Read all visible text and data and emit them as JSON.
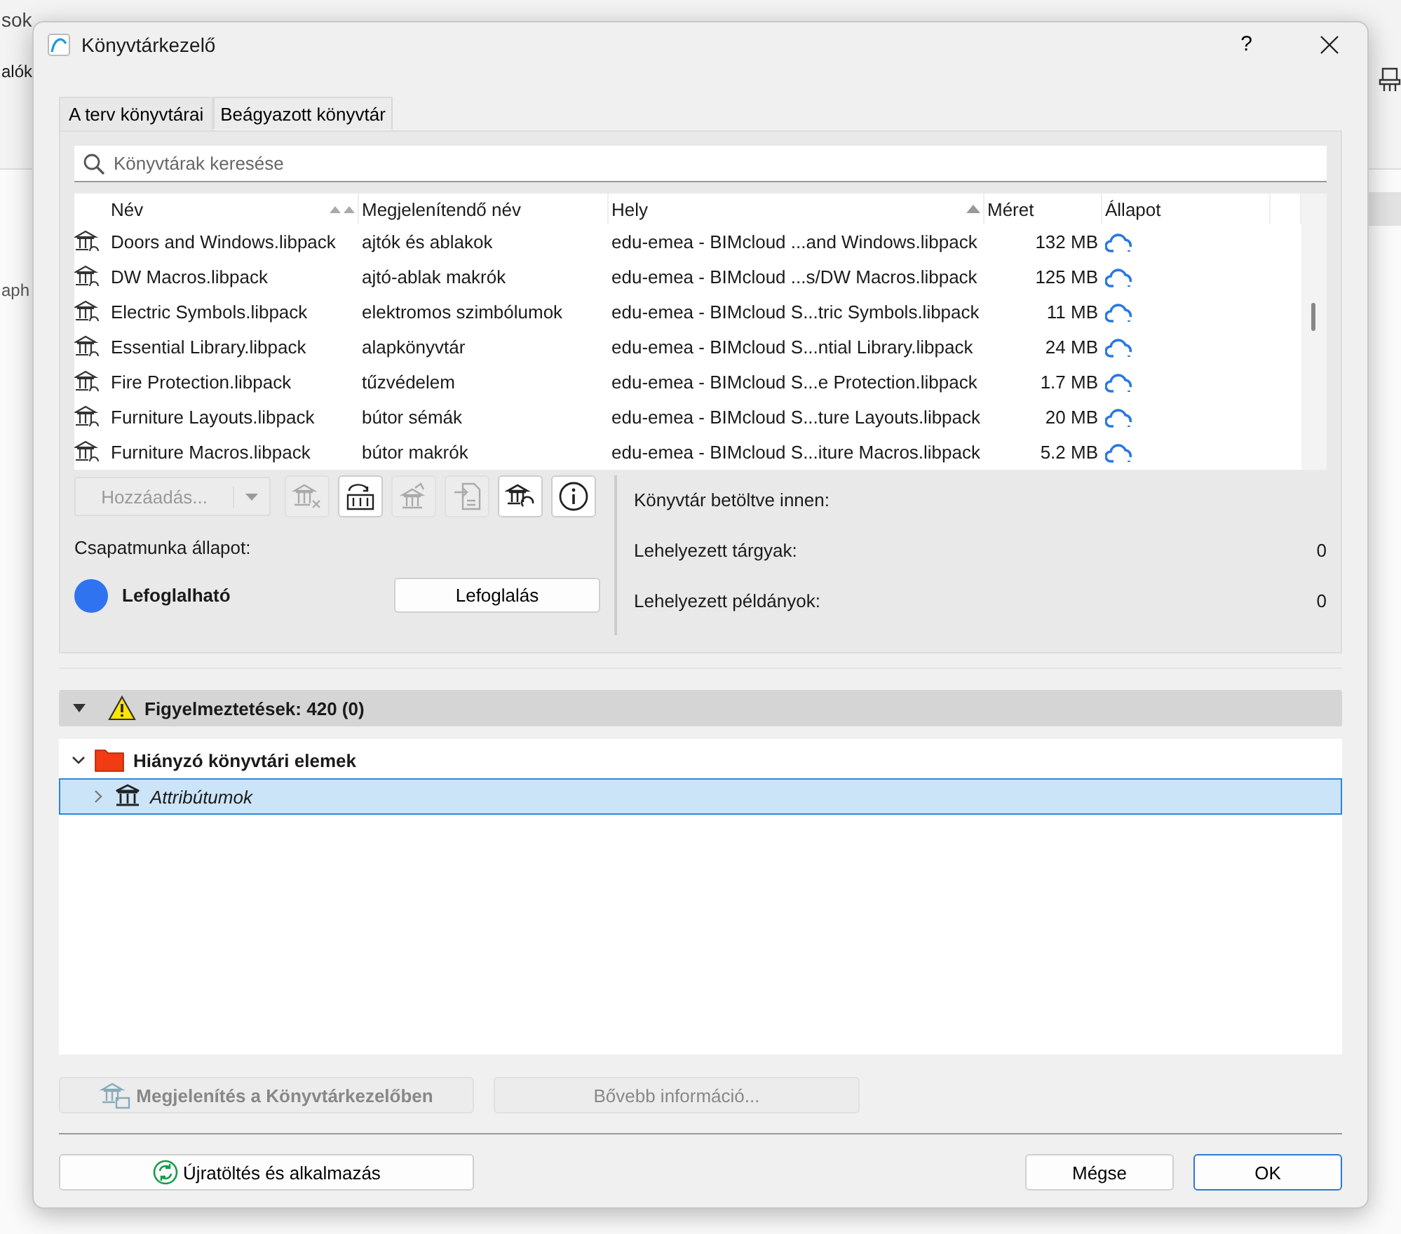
{
  "background_app": {
    "menu": [
      "sok"
    ],
    "toolbar_label": "alók",
    "side_label": "aph"
  },
  "window": {
    "title": "Könyvtárkezelő",
    "help": "?"
  },
  "tabs": [
    {
      "label": "A terv könyvtárai",
      "selected": true
    },
    {
      "label": "Beágyazott könyvtár",
      "selected": false
    }
  ],
  "search": {
    "placeholder": "Könyvtárak keresése"
  },
  "table": {
    "columns": [
      {
        "label": "Név",
        "kind": "sorted-multi"
      },
      {
        "label": "Megjelenítendő név",
        "kind": "plain"
      },
      {
        "label": "Hely",
        "kind": "sorted"
      },
      {
        "label": "Méret",
        "kind": "plain"
      },
      {
        "label": "Állapot",
        "kind": "plain"
      }
    ],
    "rows": [
      {
        "name": "Doors and Windows.libpack",
        "display": "ajtók és ablakok",
        "location": "edu-emea - BIMcloud ...and Windows.libpack",
        "size": "132 MB"
      },
      {
        "name": "DW Macros.libpack",
        "display": "ajtó-ablak makrók",
        "location": "edu-emea - BIMcloud ...s/DW Macros.libpack",
        "size": "125 MB"
      },
      {
        "name": "Electric Symbols.libpack",
        "display": "elektromos szimbólumok",
        "location": "edu-emea - BIMcloud S...tric Symbols.libpack",
        "size": "11 MB"
      },
      {
        "name": "Essential Library.libpack",
        "display": "alapkönyvtár",
        "location": "edu-emea - BIMcloud S...ntial Library.libpack",
        "size": "24 MB"
      },
      {
        "name": "Fire Protection.libpack",
        "display": "tűzvédelem",
        "location": "edu-emea - BIMcloud S...e Protection.libpack",
        "size": "1.7 MB"
      },
      {
        "name": "Furniture Layouts.libpack",
        "display": "bútor sémák",
        "location": "edu-emea - BIMcloud S...ture Layouts.libpack",
        "size": "20 MB"
      },
      {
        "name": "Furniture Macros.libpack",
        "display": "bútor makrók",
        "location": "edu-emea - BIMcloud S...iture Macros.libpack",
        "size": "5.2 MB"
      }
    ]
  },
  "toolbar": {
    "add_button": {
      "label": "Hozzáadás...",
      "disabled": true
    },
    "tools": [
      {
        "kind": "remove",
        "disabled": true
      },
      {
        "kind": "swap",
        "disabled": false
      },
      {
        "kind": "upload",
        "disabled": true
      },
      {
        "kind": "import",
        "disabled": true
      },
      {
        "kind": "refresh",
        "disabled": false
      },
      {
        "kind": "info",
        "disabled": false
      }
    ]
  },
  "teamwork": {
    "label": "Csapatmunka állapot:",
    "status": "Lefoglalható",
    "color": "#2f73f0",
    "button": "Lefoglalás"
  },
  "info": [
    {
      "label": "Könyvtár betöltve innen:"
    },
    {
      "label": "Lehelyezett tárgyak:",
      "value": "0"
    },
    {
      "label": "Lehelyezett példányok:",
      "value": "0"
    }
  ],
  "warnings": {
    "title": "Figyelmeztetések: 420 (0)",
    "expanded": true,
    "tree": [
      {
        "label": "Hiányzó könyvtári elemek",
        "expanded": true,
        "selected": false,
        "children": [
          {
            "label": "Attribútumok",
            "expanded": false,
            "selected": true
          }
        ]
      }
    ]
  },
  "actions": [
    {
      "label": "Megjelenítés a Könyvtárkezelőben",
      "disabled": true
    },
    {
      "label": "Bővebb információ...",
      "disabled": true
    }
  ],
  "footer": {
    "reload": "Újratöltés és alkalmazás",
    "cancel": "Mégse",
    "ok": "OK"
  }
}
